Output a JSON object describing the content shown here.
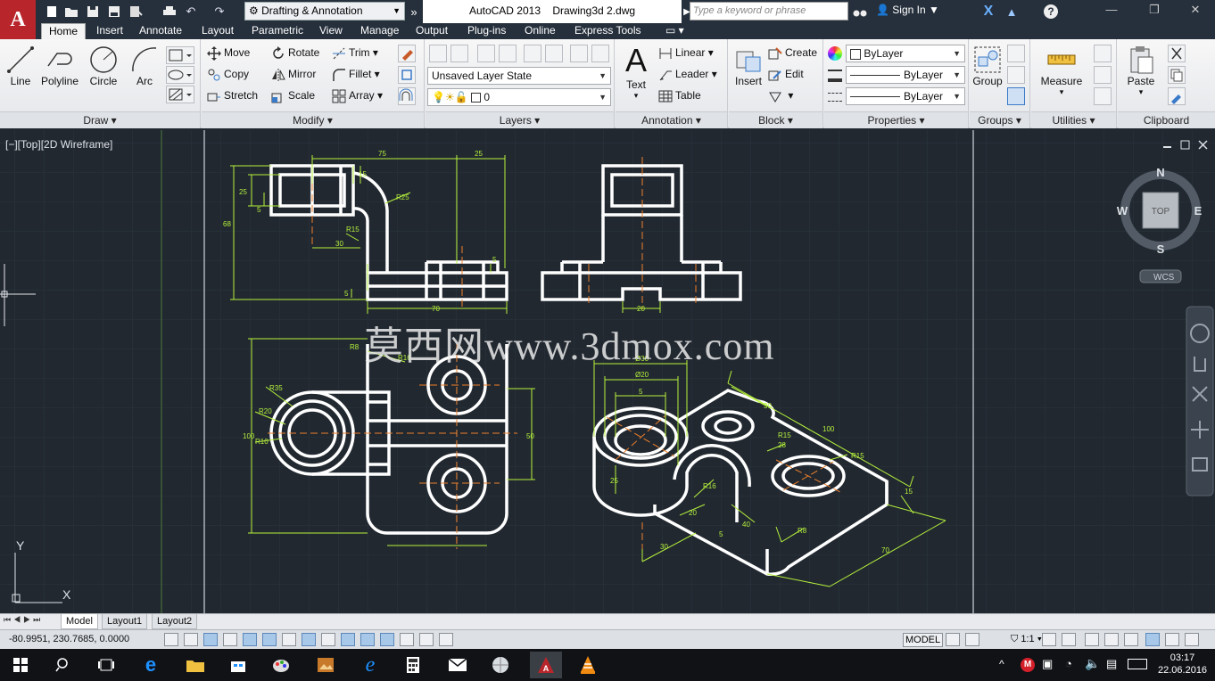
{
  "window": {
    "workspace": "Drafting & Annotation",
    "app_name": "AutoCAD 2013",
    "document": "Drawing3d 2.dwg",
    "search_placeholder": "Type a keyword or phrase",
    "sign_in": "Sign In"
  },
  "tabs": [
    {
      "label": "Home",
      "active": true
    },
    {
      "label": "Insert"
    },
    {
      "label": "Annotate"
    },
    {
      "label": "Layout"
    },
    {
      "label": "Parametric"
    },
    {
      "label": "View"
    },
    {
      "label": "Manage"
    },
    {
      "label": "Output"
    },
    {
      "label": "Plug-ins"
    },
    {
      "label": "Online"
    },
    {
      "label": "Express Tools"
    }
  ],
  "ribbon": {
    "draw": {
      "title": "Draw",
      "line": "Line",
      "polyline": "Polyline",
      "circle": "Circle",
      "arc": "Arc"
    },
    "modify": {
      "title": "Modify",
      "move": "Move",
      "rotate": "Rotate",
      "trim": "Trim",
      "copy": "Copy",
      "mirror": "Mirror",
      "fillet": "Fillet",
      "stretch": "Stretch",
      "scale": "Scale",
      "array": "Array"
    },
    "layers": {
      "title": "Layers",
      "state": "Unsaved Layer State",
      "current": "0"
    },
    "annotation": {
      "title": "Annotation",
      "text": "Text",
      "linear": "Linear",
      "leader": "Leader",
      "table": "Table"
    },
    "block": {
      "title": "Block",
      "insert": "Insert",
      "create": "Create",
      "edit": "Edit"
    },
    "properties": {
      "title": "Properties",
      "color": "ByLayer",
      "linetype": "ByLayer",
      "lineweight": "ByLayer"
    },
    "groups": {
      "title": "Groups",
      "group": "Group"
    },
    "utilities": {
      "title": "Utilities",
      "measure": "Measure"
    },
    "clipboard": {
      "title": "Clipboard",
      "paste": "Paste"
    }
  },
  "viewport": {
    "label": "[−][Top][2D Wireframe]",
    "watermark": "莫西网www.3dmox.com",
    "viewcube": {
      "north": "N",
      "south": "S",
      "east": "E",
      "west": "W",
      "face": "TOP"
    },
    "ucs": "WCS",
    "axis_y": "Y",
    "axis_x": "X",
    "dims": {
      "d75": "75",
      "d25a": "25",
      "d15": "15",
      "d25b": "25",
      "d5a": "5",
      "d68": "68",
      "r25": "R25",
      "r15": "R15",
      "d30": "30",
      "d5b": "5",
      "d5c": "5",
      "d70": "70",
      "d20": "20",
      "d100": "100",
      "d50": "50",
      "r35": "R35",
      "r20": "R20",
      "r10": "R10",
      "r8": "R8",
      "r16": "R16",
      "o30": "Ø30",
      "o20": "Ø20",
      "i5": "5",
      "i25": "25",
      "i16": "R16",
      "i20": "20",
      "i30": "30",
      "i40": "40",
      "i100": "100",
      "i15": "15",
      "i70": "70",
      "r15b": "R15",
      "r15c": "R15",
      "r8b": "R8",
      "i28": "28",
      "i5b": "5"
    }
  },
  "layout_tabs": [
    {
      "label": "Model",
      "active": true
    },
    {
      "label": "Layout1"
    },
    {
      "label": "Layout2"
    }
  ],
  "status": {
    "coords": "-80.9951, 230.7685, 0.0000",
    "model": "MODEL",
    "scale": "1:1"
  },
  "taskbar": {
    "time": "03:17",
    "date": "22.06.2016"
  },
  "colors": {
    "accent": "#b8262b",
    "viewport_bg": "#212830",
    "geometry": "#ffffff",
    "dimension": "#b6f23c",
    "centerline": "#f0802a"
  }
}
